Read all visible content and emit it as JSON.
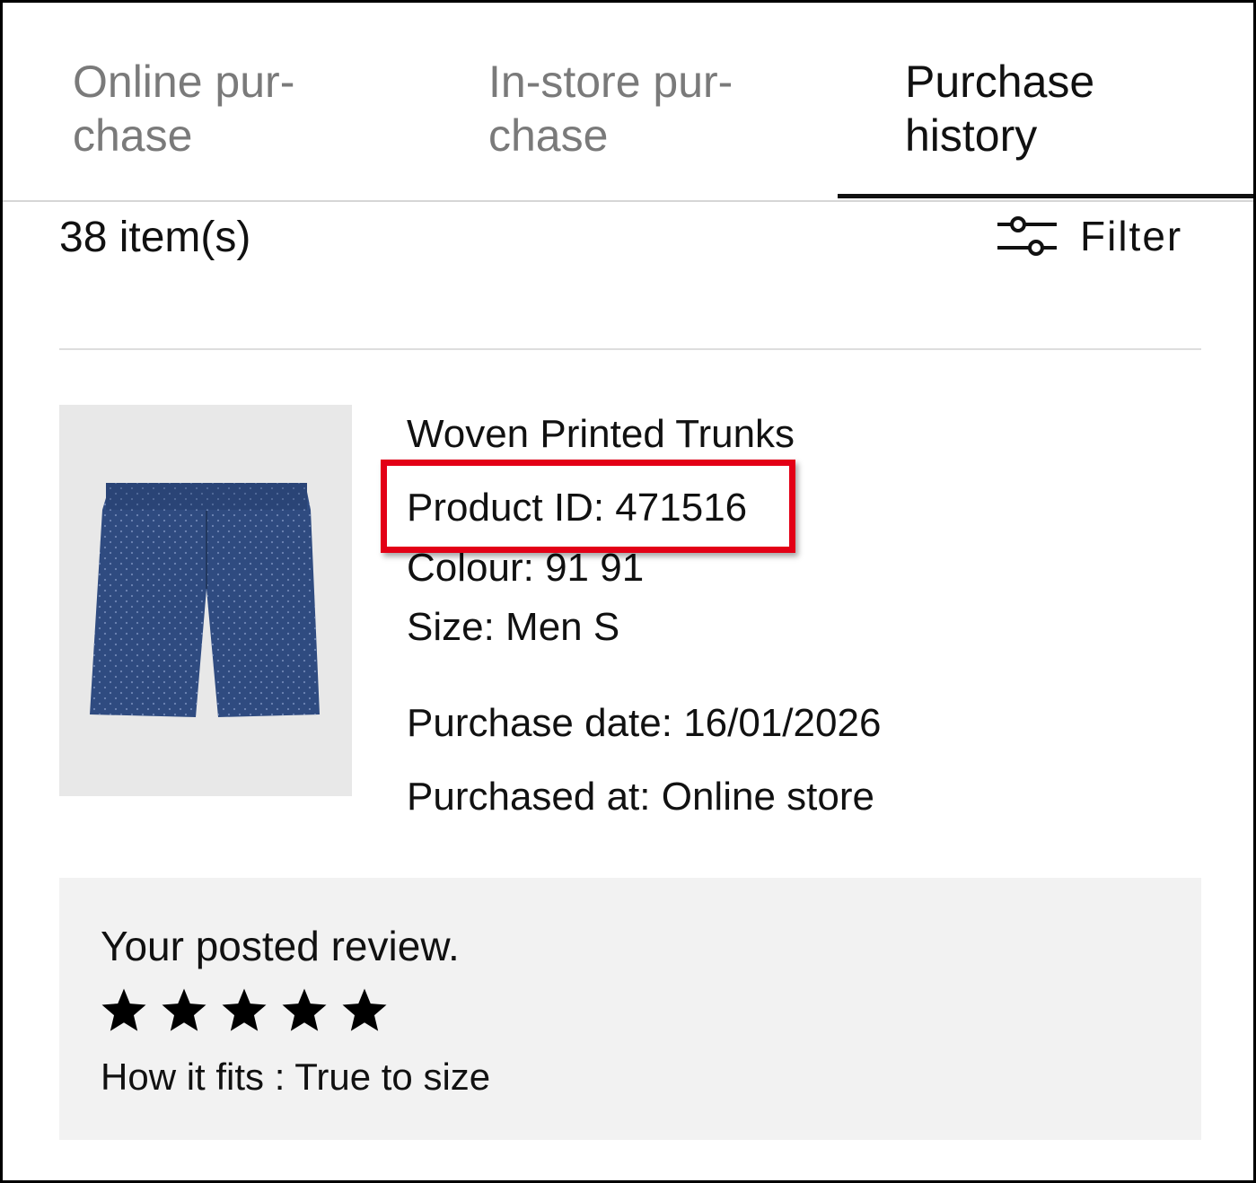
{
  "tabs": [
    {
      "label": "Online pur-\nchase",
      "active": false
    },
    {
      "label": "In-store pur-\nchase",
      "active": false
    },
    {
      "label": "Purchase\nhistory",
      "active": true
    }
  ],
  "list": {
    "count_text": "38 item(s)",
    "filter_label": "Filter",
    "filter_icon": "sliders-icon"
  },
  "product": {
    "name": "Woven Printed Trunks",
    "product_id": "Product ID: 471516",
    "colour": "Colour: 91 91",
    "size": "Size: Men S",
    "purchase_date": "Purchase date: 16/01/2026",
    "purchased_at": "Purchased at: Online store",
    "image_description": "navy printed boxer trunks",
    "image_color": "#2f4b80"
  },
  "review": {
    "title": "Your posted review.",
    "rating": 5,
    "rating_max": 5,
    "fit": "How it fits : True to size"
  },
  "colors": {
    "highlight": "#e30016",
    "inactive_tab": "#7a7a7a",
    "review_background": "#f2f2f2"
  }
}
